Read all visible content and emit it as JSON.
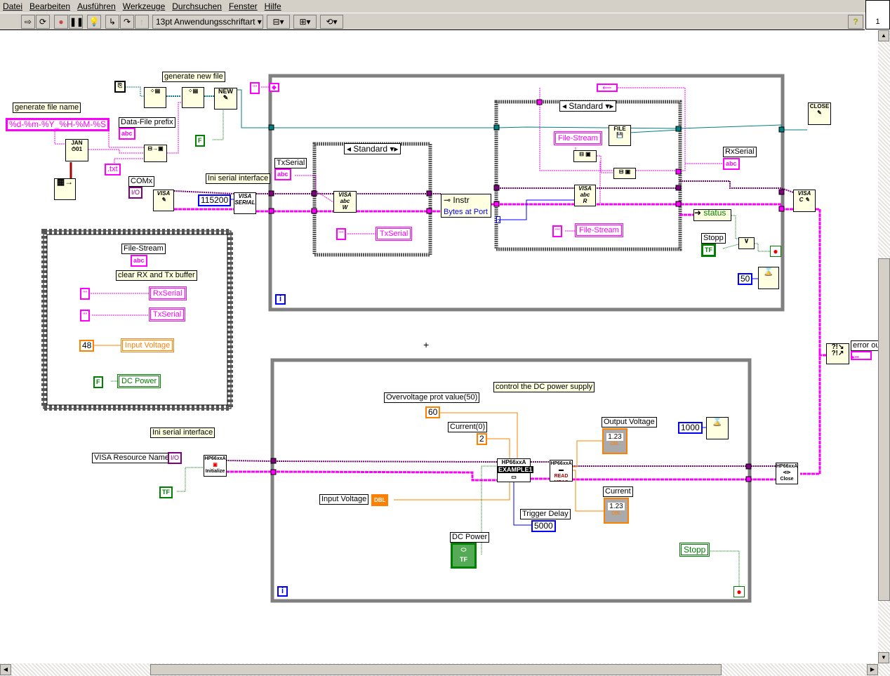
{
  "menu": [
    "Datei",
    "Bearbeiten",
    "Ausführen",
    "Werkzeuge",
    "Durchsuchen",
    "Fenster",
    "Hilfe"
  ],
  "toolbar": {
    "font": "13pt Anwendungsschriftart",
    "help": "?",
    "connector_pane": "1"
  },
  "colors": {
    "string": "#ff00ff",
    "refnum": "#008080",
    "visa": "#800080",
    "integer": "#0000ff",
    "double": "#ff8000",
    "boolean": "#008000",
    "loop": "#808080"
  },
  "diagram": {
    "generate_new_file": "generate new file",
    "generate_file_name": "generate file name",
    "format_string": "%d-%m-%Y_%H-%M-%S",
    "data_file_prefix": "Data-File prefix",
    "abc": "abc",
    "txt": ".txt",
    "tf": "TF",
    "tf_false": "F",
    "comx": "COMx",
    "io": "I/O",
    "ini_serial": "Ini serial interface",
    "baud": "115200",
    "txserial": "TxSerial",
    "standard": "Standard",
    "instr": "Instr",
    "bytes_at_port": "Bytes at Port",
    "file_stream": "File-Stream",
    "rxserial": "RxSerial",
    "status": "status",
    "stopp": "Stopp",
    "wait_ms": "50",
    "loop_i": "i",
    "new": "NEW",
    "close": "CLOSE",
    "empty_str": "\"\"",
    "error_out": "error out",
    "seq": {
      "file_stream": "File-Stream",
      "clear_buffer": "clear RX and Tx buffer",
      "rxserial": "RxSerial",
      "txserial": "TxSerial",
      "voltage_value": "48",
      "input_voltage": "Input Voltage",
      "dc_power": "DC Power"
    },
    "lower": {
      "ini_serial": "Ini serial interface",
      "visa_resource": "VISA Resource Name",
      "control_dc": "control the DC power supply",
      "ovp_label": "Overvoltage prot value(50)",
      "ovp": "60",
      "current_label": "Current(0)",
      "current": "2",
      "input_voltage": "Input Voltage",
      "dbl": "DBL",
      "trigger_delay": "Trigger Delay",
      "trigger_value": "5000",
      "dc_power": "DC Power",
      "output_voltage": "Output Voltage",
      "current_ind": "Current",
      "ind_value": "1.23",
      "wait_ms": "1000",
      "stopp": "Stopp",
      "hp_init": "HP66xxA",
      "initialize": "Initialize",
      "example": "EXAMPLE1",
      "read_meas": "READ MEAS",
      "close": "Close"
    }
  }
}
